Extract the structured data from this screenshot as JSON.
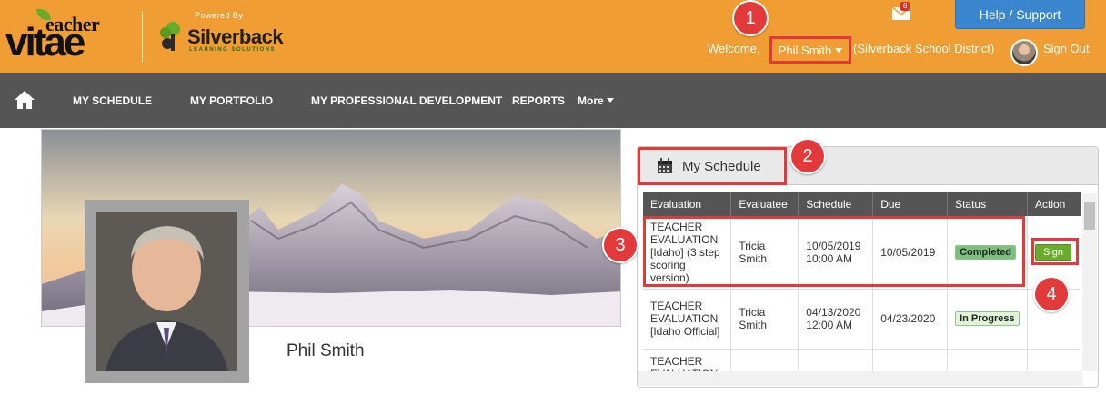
{
  "header": {
    "logo": {
      "teacher": "eacher",
      "vitae": "vitae"
    },
    "partner": {
      "powered_by": "Powered By",
      "name": "Silverback",
      "sub": "LEARNING SOLUTIONS"
    },
    "mail_count": "8",
    "help_label": "Help / Support",
    "welcome_label": "Welcome,",
    "user_name": "Phil Smith",
    "district": "(Silverback School District)",
    "signout_label": "Sign Out"
  },
  "nav": {
    "items": [
      "MY SCHEDULE",
      "MY PORTFOLIO",
      "MY PROFESSIONAL DEVELOPMENT",
      "REPORTS"
    ],
    "more_label": "More"
  },
  "profile": {
    "name": "Phil Smith"
  },
  "schedule": {
    "title": "My Schedule",
    "columns": [
      "Evaluation",
      "Evaluatee",
      "Schedule",
      "Due",
      "Status",
      "Action"
    ],
    "rows": [
      {
        "evaluation": "TEACHER EVALUATION [Idaho] (3 step scoring version)",
        "evaluatee": "Tricia Smith",
        "schedule": "10/05/2019 10:00 AM",
        "due": "10/05/2019",
        "status": "Completed",
        "action": "Sign"
      },
      {
        "evaluation": "TEACHER EVALUATION [Idaho Official]",
        "evaluatee": "Tricia Smith",
        "schedule": "04/13/2020 12:00 AM",
        "due": "04/23/2020",
        "status": "In Progress",
        "action": ""
      },
      {
        "evaluation": "TEACHER EVALUATION",
        "evaluatee": "",
        "schedule": "",
        "due": "",
        "status": "",
        "action": ""
      }
    ]
  },
  "callouts": [
    "1",
    "2",
    "3",
    "4"
  ],
  "colors": {
    "header": "#f09d33",
    "nav": "#555555",
    "callout": "#e23a3a",
    "help": "#3a87cf",
    "sign": "#6bab2b"
  }
}
